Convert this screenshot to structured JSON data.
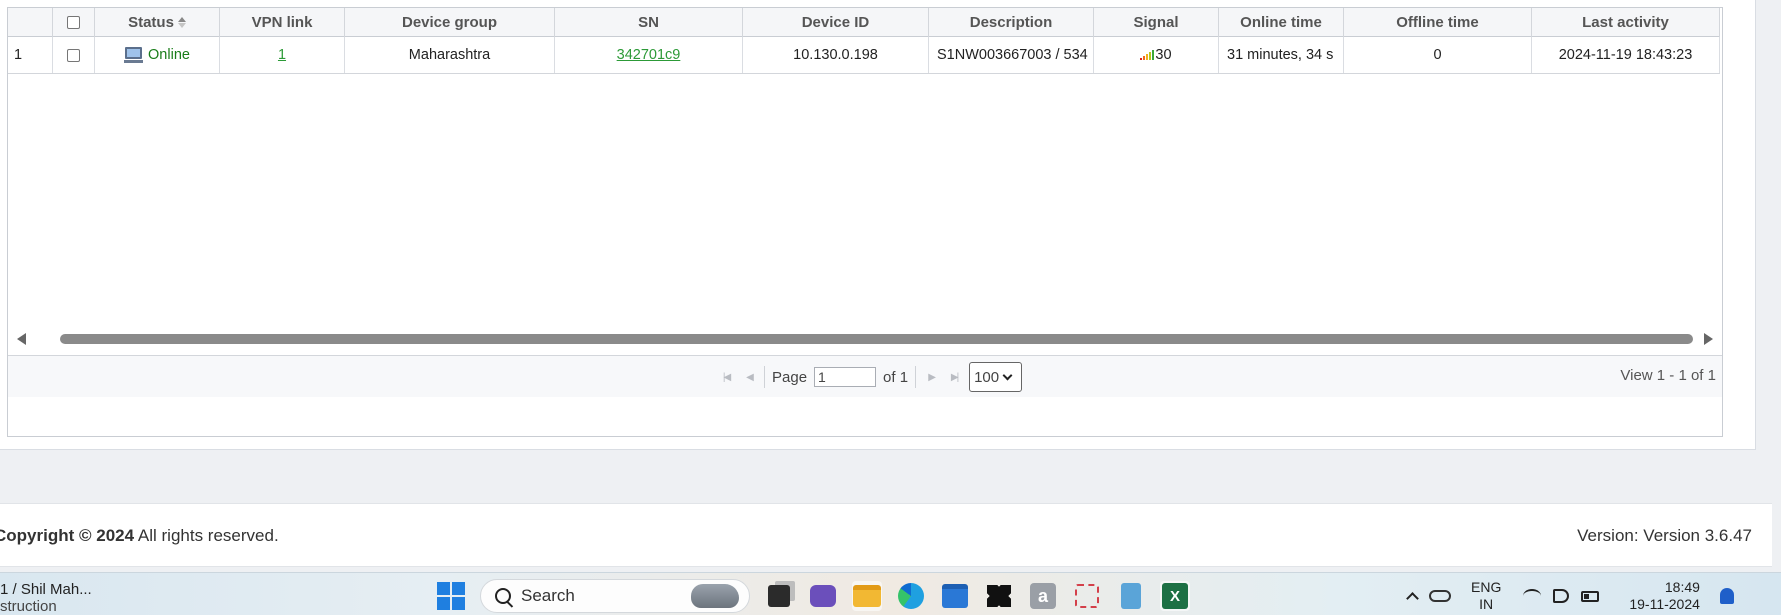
{
  "table": {
    "columns": [
      "",
      "",
      "Status",
      "VPN link",
      "Device group",
      "SN",
      "Device ID",
      "Description",
      "Signal",
      "Online time",
      "Offline time",
      "Last activity"
    ],
    "rows": [
      {
        "index": "1",
        "status": "Online",
        "vpn_link": "1",
        "device_group": "Maharashtra",
        "sn": "342701c9",
        "device_id": "10.130.0.198",
        "description": "S1NW003667003 / 534",
        "signal": "30",
        "online_time": "31 minutes, 34 s",
        "offline_time": "0",
        "last_activity": "2024-11-19 18:43:23"
      }
    ]
  },
  "pager": {
    "page_label": "Page",
    "page_value": "1",
    "of_label": "of 1",
    "page_size": "100",
    "view_text": "View 1 - 1 of 1"
  },
  "footer": {
    "copyright_prefix": "Copyright ©",
    "copyright_year": "2024",
    "copyright_suffix": "All rights reserved.",
    "version": "Version: Version 3.6.47"
  },
  "taskbar": {
    "window_title_line1": "1 / Shil Mah...",
    "window_title_line2": "struction",
    "search_label": "Search",
    "amazon_glyph": "a",
    "excel_glyph": "X",
    "lang_line1": "ENG",
    "lang_line2": "IN",
    "time": "18:49",
    "date": "19-11-2024"
  },
  "colors": {
    "link": "#2c9a37",
    "online": "#1a7d1a",
    "signal_bars": [
      "#e02020",
      "#f06a1c",
      "#f2b01c",
      "#b6c81c",
      "#3aa83a"
    ]
  }
}
